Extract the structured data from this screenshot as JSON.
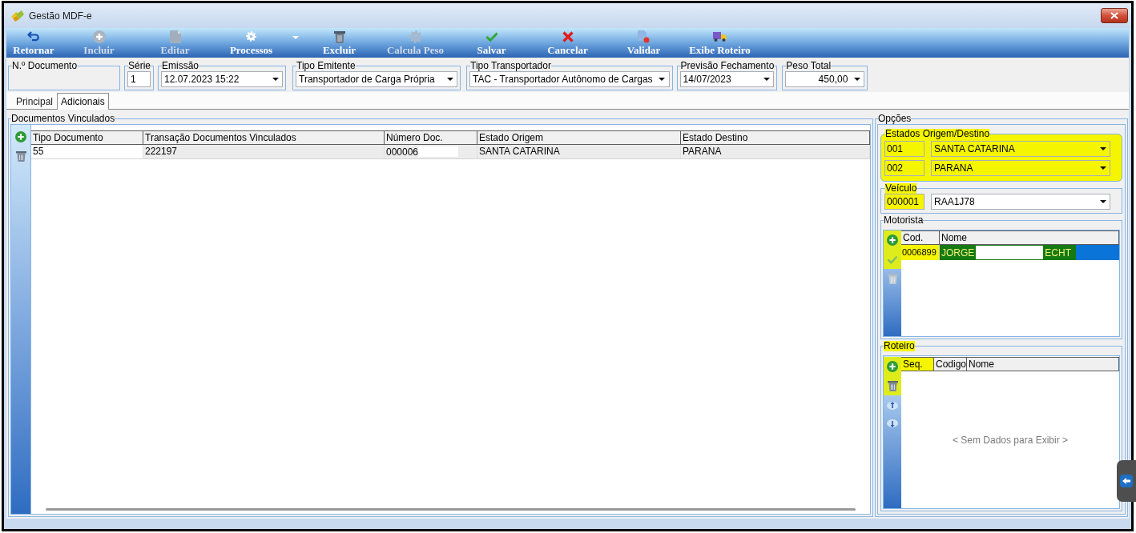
{
  "window": {
    "title": "Gestão MDF-e"
  },
  "toolbar": [
    {
      "label": "Retornar",
      "kind": "return",
      "disabled": false
    },
    {
      "label": "Incluir",
      "kind": "add",
      "disabled": true
    },
    {
      "label": "Editar",
      "kind": "edit",
      "disabled": true
    },
    {
      "label": "Processos",
      "kind": "processes",
      "disabled": false,
      "dropdown": true
    },
    {
      "label": "Excluir",
      "kind": "delete",
      "disabled": false
    },
    {
      "label": "Calcula Peso",
      "kind": "calculate",
      "disabled": true
    },
    {
      "label": "Salvar",
      "kind": "save",
      "disabled": false
    },
    {
      "label": "Cancelar",
      "kind": "cancel",
      "disabled": false
    },
    {
      "label": "Validar",
      "kind": "validate",
      "disabled": false
    },
    {
      "label": "Exibe Roteiro",
      "kind": "route",
      "disabled": false
    }
  ],
  "header_fields": [
    {
      "label": "N.º Documento",
      "kind": "blank"
    },
    {
      "label": "Série",
      "kind": "text",
      "value": "1"
    },
    {
      "label": "Emissão",
      "kind": "combo",
      "value": "12.07.2023 15:22"
    },
    {
      "label": "Tipo Emitente",
      "kind": "combo",
      "value": "Transportador de Carga Própria"
    },
    {
      "label": "Tipo Transportador",
      "kind": "combo",
      "value": "TAC - Transportador Autônomo de Cargas"
    },
    {
      "label": "Previsão Fechamento",
      "kind": "combo",
      "value": "14/07/2023"
    },
    {
      "label": "Peso Total",
      "kind": "amount",
      "value": "450,00"
    }
  ],
  "tabs": [
    {
      "label": "Principal",
      "selected": false
    },
    {
      "label": "Adicionais",
      "selected": true
    }
  ],
  "documentos_vinculados": {
    "title": "Documentos Vinculados",
    "tools": [
      {
        "kind": "add",
        "disabled": false
      },
      {
        "kind": "delete",
        "disabled": false
      }
    ],
    "columns": [
      "Tipo Documento",
      "Transação Documentos Vinculados",
      "Número Doc.",
      "Estado Origem",
      "Estado Destino"
    ],
    "rows": [
      {
        "selected": true,
        "cells": [
          {
            "text": "55",
            "focused": true,
            "redacted": false
          },
          {
            "text": "222197",
            "focused": false,
            "redacted": false
          },
          {
            "text": "000006",
            "focused": false,
            "redacted": true
          },
          {
            "text": "SANTA CATARINA",
            "focused": false,
            "redacted": false
          },
          {
            "text": "PARANA",
            "focused": false,
            "redacted": false
          }
        ]
      }
    ]
  },
  "opcoes": {
    "title": "Opções",
    "estados": {
      "title": "Estados Origem/Destino",
      "highlighted": true,
      "rows": [
        {
          "code": "001",
          "name": "SANTA CATARINA"
        },
        {
          "code": "002",
          "name": "PARANA"
        }
      ]
    },
    "veiculo": {
      "title": "Veículo",
      "highlighted": true,
      "code": "000001",
      "name": "RAA1J78"
    },
    "motorista": {
      "title": "Motorista",
      "tools": [
        {
          "kind": "add",
          "disabled": false,
          "highlighted": true
        },
        {
          "kind": "confirm",
          "disabled": true,
          "highlighted": true
        },
        {
          "kind": "delete",
          "disabled": true,
          "highlighted": false
        }
      ],
      "columns": [
        "Cod.",
        "Nome"
      ],
      "rows": [
        {
          "selected": true,
          "highlighted": true,
          "redacted": true,
          "code": "0006899",
          "name_parts": [
            "JORGE",
            "ECHT"
          ]
        }
      ]
    },
    "roteiro": {
      "title": "Roteiro",
      "highlighted": true,
      "tools": [
        {
          "kind": "add",
          "disabled": false,
          "highlighted": true
        },
        {
          "kind": "delete",
          "disabled": false,
          "highlighted": true
        },
        {
          "kind": "move_up",
          "disabled": false,
          "highlighted": false
        },
        {
          "kind": "move_down",
          "disabled": false,
          "highlighted": false
        }
      ],
      "columns": [
        {
          "label": "Seq.",
          "highlighted": true
        },
        {
          "label": "Codigo",
          "highlighted": false
        },
        {
          "label": "Nome",
          "highlighted": false
        }
      ],
      "empty_message": "< Sem Dados para Exibir >"
    }
  }
}
